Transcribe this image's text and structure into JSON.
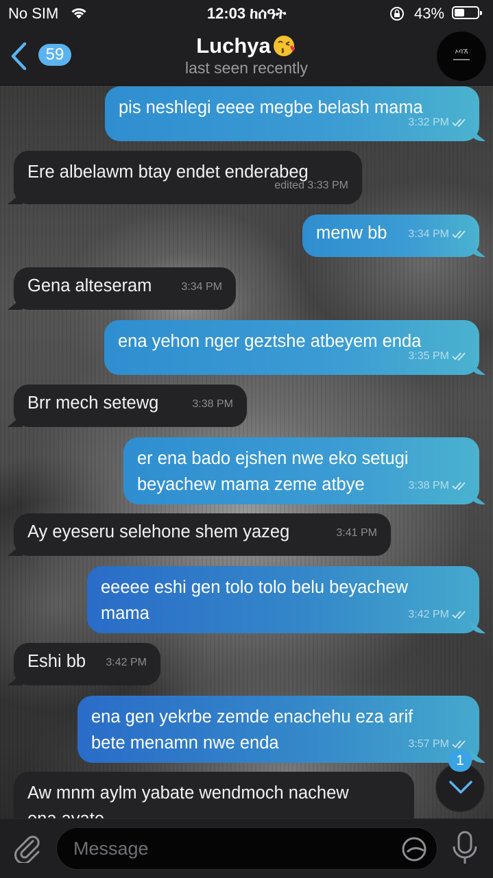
{
  "status_bar": {
    "carrier": "No SIM",
    "time": "12:03 ከሰዓት",
    "battery": "43%",
    "battery_level": 0.43
  },
  "header": {
    "back_count": "59",
    "contact_name": "Luchya",
    "last_seen": "last seen recently",
    "accent_color": "#5ab3f0"
  },
  "messages": [
    {
      "dir": "out",
      "text": "pis neshlegi eeee megbe belash mama",
      "time": "3:32 PM",
      "read": true
    },
    {
      "dir": "in",
      "text": "Ere albelawm btay endet enderabeg",
      "time": "edited 3:33 PM"
    },
    {
      "dir": "out",
      "text": "menw bb",
      "time": "3:34 PM",
      "read": true
    },
    {
      "dir": "in",
      "text": "Gena alteseram",
      "time": "3:34 PM"
    },
    {
      "dir": "out",
      "text": "ena yehon nger geztshe atbeyem enda",
      "time": "3:35 PM",
      "read": true
    },
    {
      "dir": "in",
      "text": "Brr mech setewg",
      "time": "3:38 PM"
    },
    {
      "dir": "out",
      "text": "er ena bado ejshen nwe eko setugi\nbeyachew mama zeme atbye",
      "time": "3:38 PM",
      "read": true
    },
    {
      "dir": "in",
      "text": "Ay eyeseru selehone shem yazeg",
      "time": "3:41 PM"
    },
    {
      "dir": "out",
      "text": "eeeee eshi gen tolo tolo belu beyachew\nmama",
      "time": "3:42 PM",
      "read": true
    },
    {
      "dir": "in",
      "text": "Eshi bb",
      "time": "3:42 PM"
    },
    {
      "dir": "out",
      "text": "ena gen yekrbe zemde enachehu eza arif\nbete menamn nwe enda",
      "time": "3:57 PM",
      "read": true
    },
    {
      "dir": "in",
      "text": "Aw mnm aylm yabate wendmoch nachew\nena ayate",
      "time": ""
    }
  ],
  "scroll_button": {
    "badge": "1"
  },
  "input": {
    "placeholder": "Message"
  },
  "icons": {
    "back": "chevron-left-icon",
    "attach": "paperclip-icon",
    "sticker": "sticker-icon",
    "mic": "microphone-icon",
    "scroll": "chevron-down-icon",
    "read_receipt": "double-check-icon"
  }
}
